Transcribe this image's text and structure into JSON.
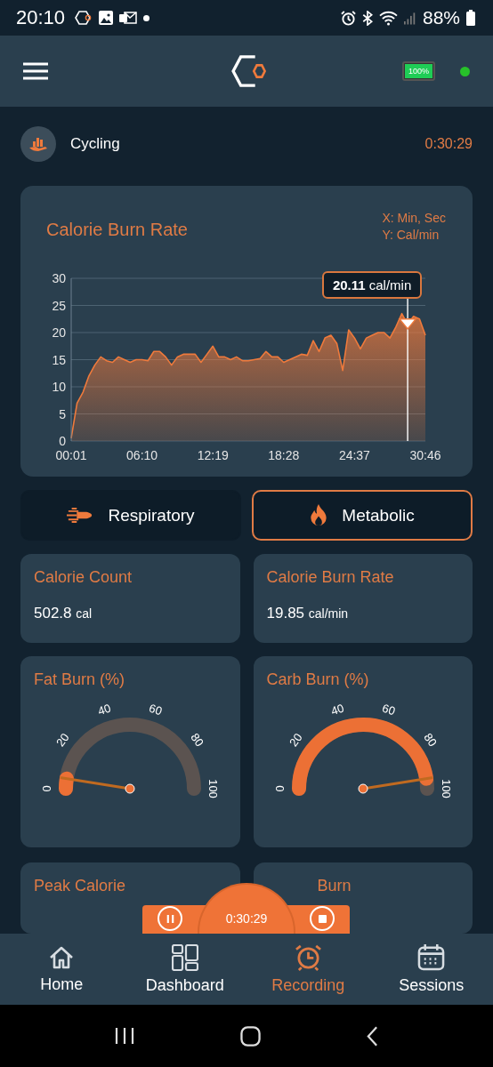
{
  "status_bar": {
    "time": "20:10",
    "battery": "88%"
  },
  "header": {
    "device_battery": "100%"
  },
  "activity": {
    "name": "Cycling",
    "elapsed": "0:30:29"
  },
  "chart_card": {
    "chart_data": {
      "type": "area",
      "title": "Calorie Burn Rate",
      "xlabel": "X: Min, Sec",
      "ylabel": "Y: Cal/min",
      "categories": [
        "00:01",
        null,
        null,
        null,
        null,
        null,
        null,
        null,
        null,
        null,
        null,
        null,
        "06:10",
        null,
        null,
        null,
        null,
        null,
        null,
        null,
        null,
        null,
        null,
        null,
        "12:19",
        null,
        null,
        null,
        null,
        null,
        null,
        null,
        null,
        null,
        null,
        null,
        "18:28",
        null,
        null,
        null,
        null,
        null,
        null,
        null,
        null,
        null,
        null,
        null,
        "24:37",
        null,
        null,
        null,
        null,
        null,
        null,
        null,
        null,
        null,
        null,
        null,
        "30:46"
      ],
      "series": [
        {
          "color": "#ef7a3c",
          "values": [
            0.5,
            7,
            9,
            12,
            14,
            15.5,
            14.8,
            14.5,
            15.5,
            15,
            14.5,
            15,
            15,
            14.8,
            16.5,
            16.5,
            15.5,
            14,
            15.5,
            16,
            16,
            16,
            14.5,
            16,
            17.5,
            15.5,
            15.5,
            15,
            15.5,
            14.8,
            14.8,
            15,
            15.2,
            16.5,
            15.5,
            15.5,
            14.5,
            15,
            15.5,
            16,
            15.8,
            18.5,
            16.5,
            19,
            19.5,
            18,
            13,
            20.5,
            19,
            17,
            19,
            19.5,
            20,
            20,
            19,
            21,
            23.5,
            21.5,
            23,
            22.5,
            19.5
          ]
        }
      ],
      "ylim": [
        0,
        30
      ],
      "grid": true,
      "yticks": [
        0,
        5,
        10,
        15,
        20,
        25,
        30
      ],
      "annotations": [
        {
          "text": "**20.11** cal/min"
        }
      ]
    }
  },
  "tabs": [
    {
      "label": "Respiratory",
      "selected": false
    },
    {
      "label": "Metabolic",
      "selected": true
    }
  ],
  "metrics": [
    {
      "title": "Calorie Count",
      "value": "502.8",
      "unit": "cal"
    },
    {
      "title": "Calorie Burn Rate",
      "value": "19.85",
      "unit": "cal/min"
    }
  ],
  "gauges": [
    {
      "title": "Fat Burn (%)",
      "level": 0.05,
      "ticks": [
        "0",
        "20",
        "40",
        "60",
        "80",
        "100"
      ]
    },
    {
      "title": "Carb Burn (%)",
      "level": 0.95,
      "ticks": [
        "0",
        "20",
        "40",
        "60",
        "80",
        "100"
      ]
    }
  ],
  "partial_cards": [
    {
      "title": "Peak Calorie"
    },
    {
      "title": "Burn"
    }
  ],
  "recorder": {
    "elapsed": "0:30:29"
  },
  "nav": [
    {
      "label": "Home",
      "selected": false
    },
    {
      "label": "Dashboard",
      "selected": false
    },
    {
      "label": "Recording",
      "selected": true
    },
    {
      "label": "Sessions",
      "selected": false
    }
  ]
}
